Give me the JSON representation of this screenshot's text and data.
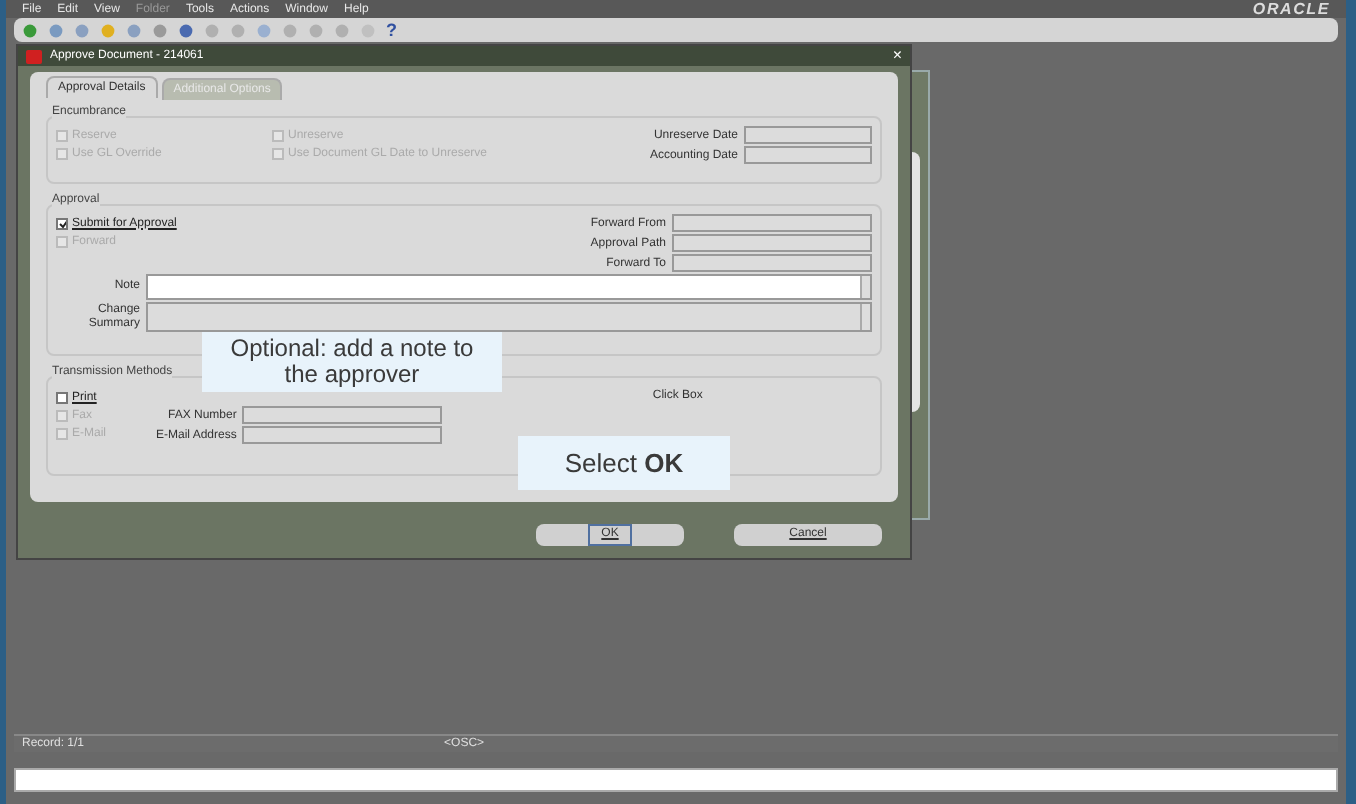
{
  "menu": [
    {
      "label": "File",
      "disabled": false
    },
    {
      "label": "Edit",
      "disabled": false
    },
    {
      "label": "View",
      "disabled": false
    },
    {
      "label": "Folder",
      "disabled": true
    },
    {
      "label": "Tools",
      "disabled": false
    },
    {
      "label": "Actions",
      "disabled": false
    },
    {
      "label": "Window",
      "disabled": false
    },
    {
      "label": "Help",
      "disabled": false
    }
  ],
  "toolbar_help": "?",
  "logo": "ORACLE",
  "dialog": {
    "title": "Approve Document - 214061",
    "close": "×",
    "tabs": [
      {
        "label": "Approval Details",
        "selected": true
      },
      {
        "label": "Additional Options",
        "selected": false
      }
    ],
    "encumbrance": {
      "title": "Encumbrance",
      "checks": [
        {
          "label": "Reserve",
          "checked": false,
          "disabled": true
        },
        {
          "label": "Unreserve",
          "checked": false,
          "disabled": true
        },
        {
          "label": "Use GL Override",
          "checked": false,
          "disabled": true
        },
        {
          "label": "Use Document GL Date to Unreserve",
          "checked": false,
          "disabled": true
        }
      ],
      "fields": [
        {
          "label": "Unreserve Date"
        },
        {
          "label": "Accounting Date"
        }
      ]
    },
    "approval": {
      "title": "Approval",
      "checks": [
        {
          "label": "Submit for Approval",
          "checked": true,
          "disabled": false
        },
        {
          "label": "Forward",
          "checked": false,
          "disabled": true
        }
      ],
      "fields": [
        {
          "label": "Forward From"
        },
        {
          "label": "Approval Path"
        },
        {
          "label": "Forward To"
        }
      ],
      "note_label": "Note",
      "summary_label": "Change Summary"
    },
    "transmission": {
      "title": "Transmission Methods",
      "hint": "Click Box",
      "checks": [
        {
          "label": "Print",
          "checked": false,
          "disabled": false
        },
        {
          "label": "Fax",
          "checked": false,
          "disabled": true
        },
        {
          "label": "E-Mail",
          "checked": false,
          "disabled": true
        }
      ],
      "fields": [
        {
          "label": "FAX Number"
        },
        {
          "label": "E-Mail Address"
        }
      ]
    },
    "buttons": [
      {
        "label": "OK",
        "focused": true
      },
      {
        "label": "Cancel",
        "focused": false
      }
    ]
  },
  "callouts": [
    {
      "text": "Optional: add a note to the approver"
    },
    {
      "text": "Select **OK**"
    }
  ],
  "status_bar": {
    "record": "Record: 1/1",
    "mode": "<OSC>"
  }
}
